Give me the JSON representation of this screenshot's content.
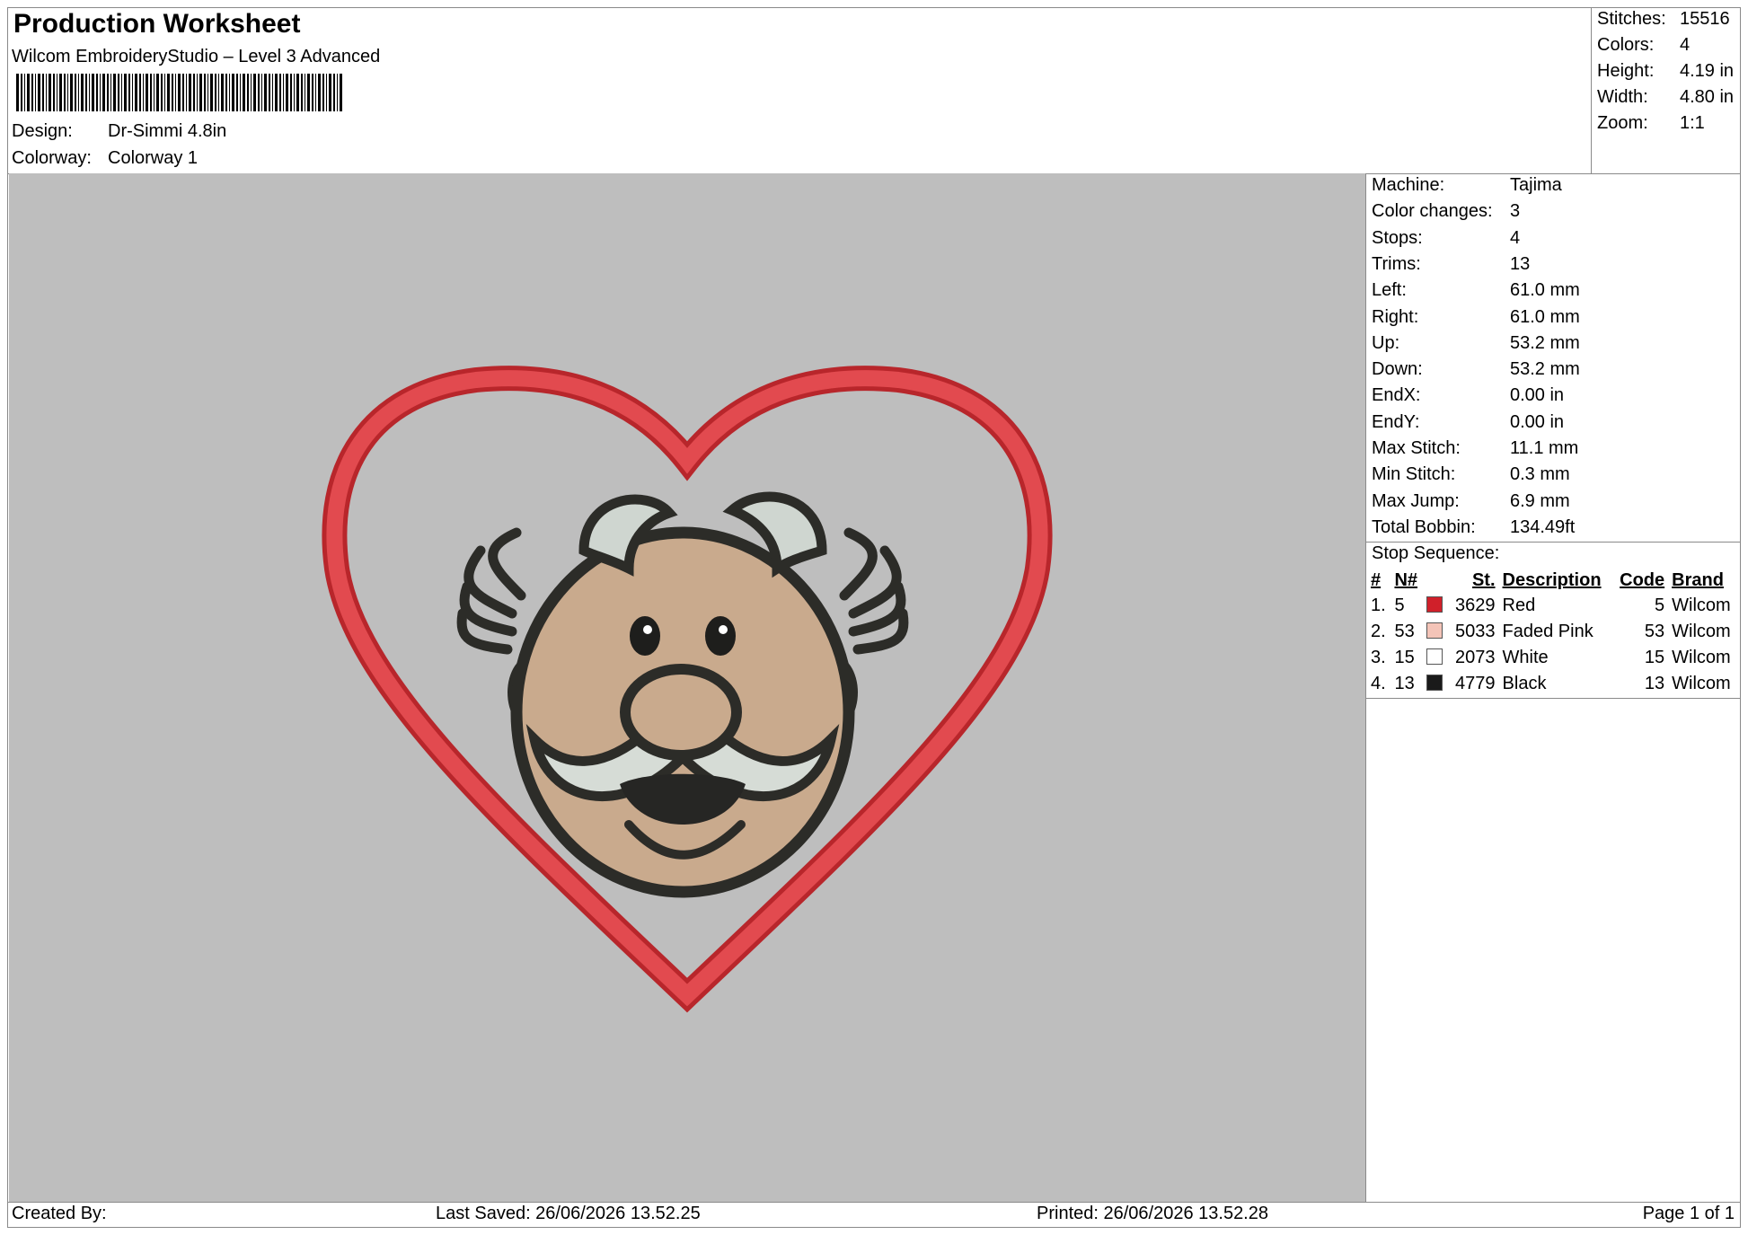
{
  "header": {
    "title": "Production Worksheet",
    "software": "Wilcom EmbroideryStudio – Level 3 Advanced",
    "design_label": "Design:",
    "design_value": "Dr-Simmi 4.8in",
    "colorway_label": "Colorway:",
    "colorway_value": "Colorway 1"
  },
  "summary": [
    {
      "label": "Stitches:",
      "value": "15516"
    },
    {
      "label": "Colors:",
      "value": "4"
    },
    {
      "label": "Height:",
      "value": "4.19 in"
    },
    {
      "label": "Width:",
      "value": "4.80 in"
    },
    {
      "label": "Zoom:",
      "value": "1:1"
    }
  ],
  "machine_info": [
    {
      "label": "Machine:",
      "value": "Tajima"
    },
    {
      "label": "Color changes:",
      "value": "3"
    },
    {
      "label": "Stops:",
      "value": "4"
    },
    {
      "label": "Trims:",
      "value": "13"
    },
    {
      "label": "Left:",
      "value": "61.0 mm"
    },
    {
      "label": "Right:",
      "value": "61.0 mm"
    },
    {
      "label": "Up:",
      "value": "53.2 mm"
    },
    {
      "label": "Down:",
      "value": "53.2 mm"
    },
    {
      "label": "EndX:",
      "value": "0.00 in"
    },
    {
      "label": "EndY:",
      "value": "0.00 in"
    },
    {
      "label": "Max Stitch:",
      "value": "11.1 mm"
    },
    {
      "label": "Min Stitch:",
      "value": "0.3 mm"
    },
    {
      "label": "Max Jump:",
      "value": "6.9 mm"
    },
    {
      "label": "Total Bobbin:",
      "value": "134.49ft"
    }
  ],
  "stop_sequence": {
    "title": "Stop Sequence:",
    "columns": [
      "#",
      "N#",
      "St.",
      "Description",
      "Code",
      "Brand"
    ],
    "rows": [
      {
        "idx": "1.",
        "n": "5",
        "color": "#d0202a",
        "st": "3629",
        "desc": "Red",
        "code": "5",
        "brand": "Wilcom"
      },
      {
        "idx": "2.",
        "n": "53",
        "color": "#f4c4b8",
        "st": "5033",
        "desc": "Faded Pink",
        "code": "53",
        "brand": "Wilcom"
      },
      {
        "idx": "3.",
        "n": "15",
        "color": "#ffffff",
        "st": "2073",
        "desc": "White",
        "code": "15",
        "brand": "Wilcom"
      },
      {
        "idx": "4.",
        "n": "13",
        "color": "#1a1a1a",
        "st": "4779",
        "desc": "Black",
        "code": "13",
        "brand": "Wilcom"
      }
    ]
  },
  "footer": {
    "created_by": "Created By:",
    "last_saved": "Last Saved: 26/06/2026 13.52.25",
    "printed": "Printed: 26/06/2026 13.52.28",
    "page": "Page 1 of 1"
  }
}
